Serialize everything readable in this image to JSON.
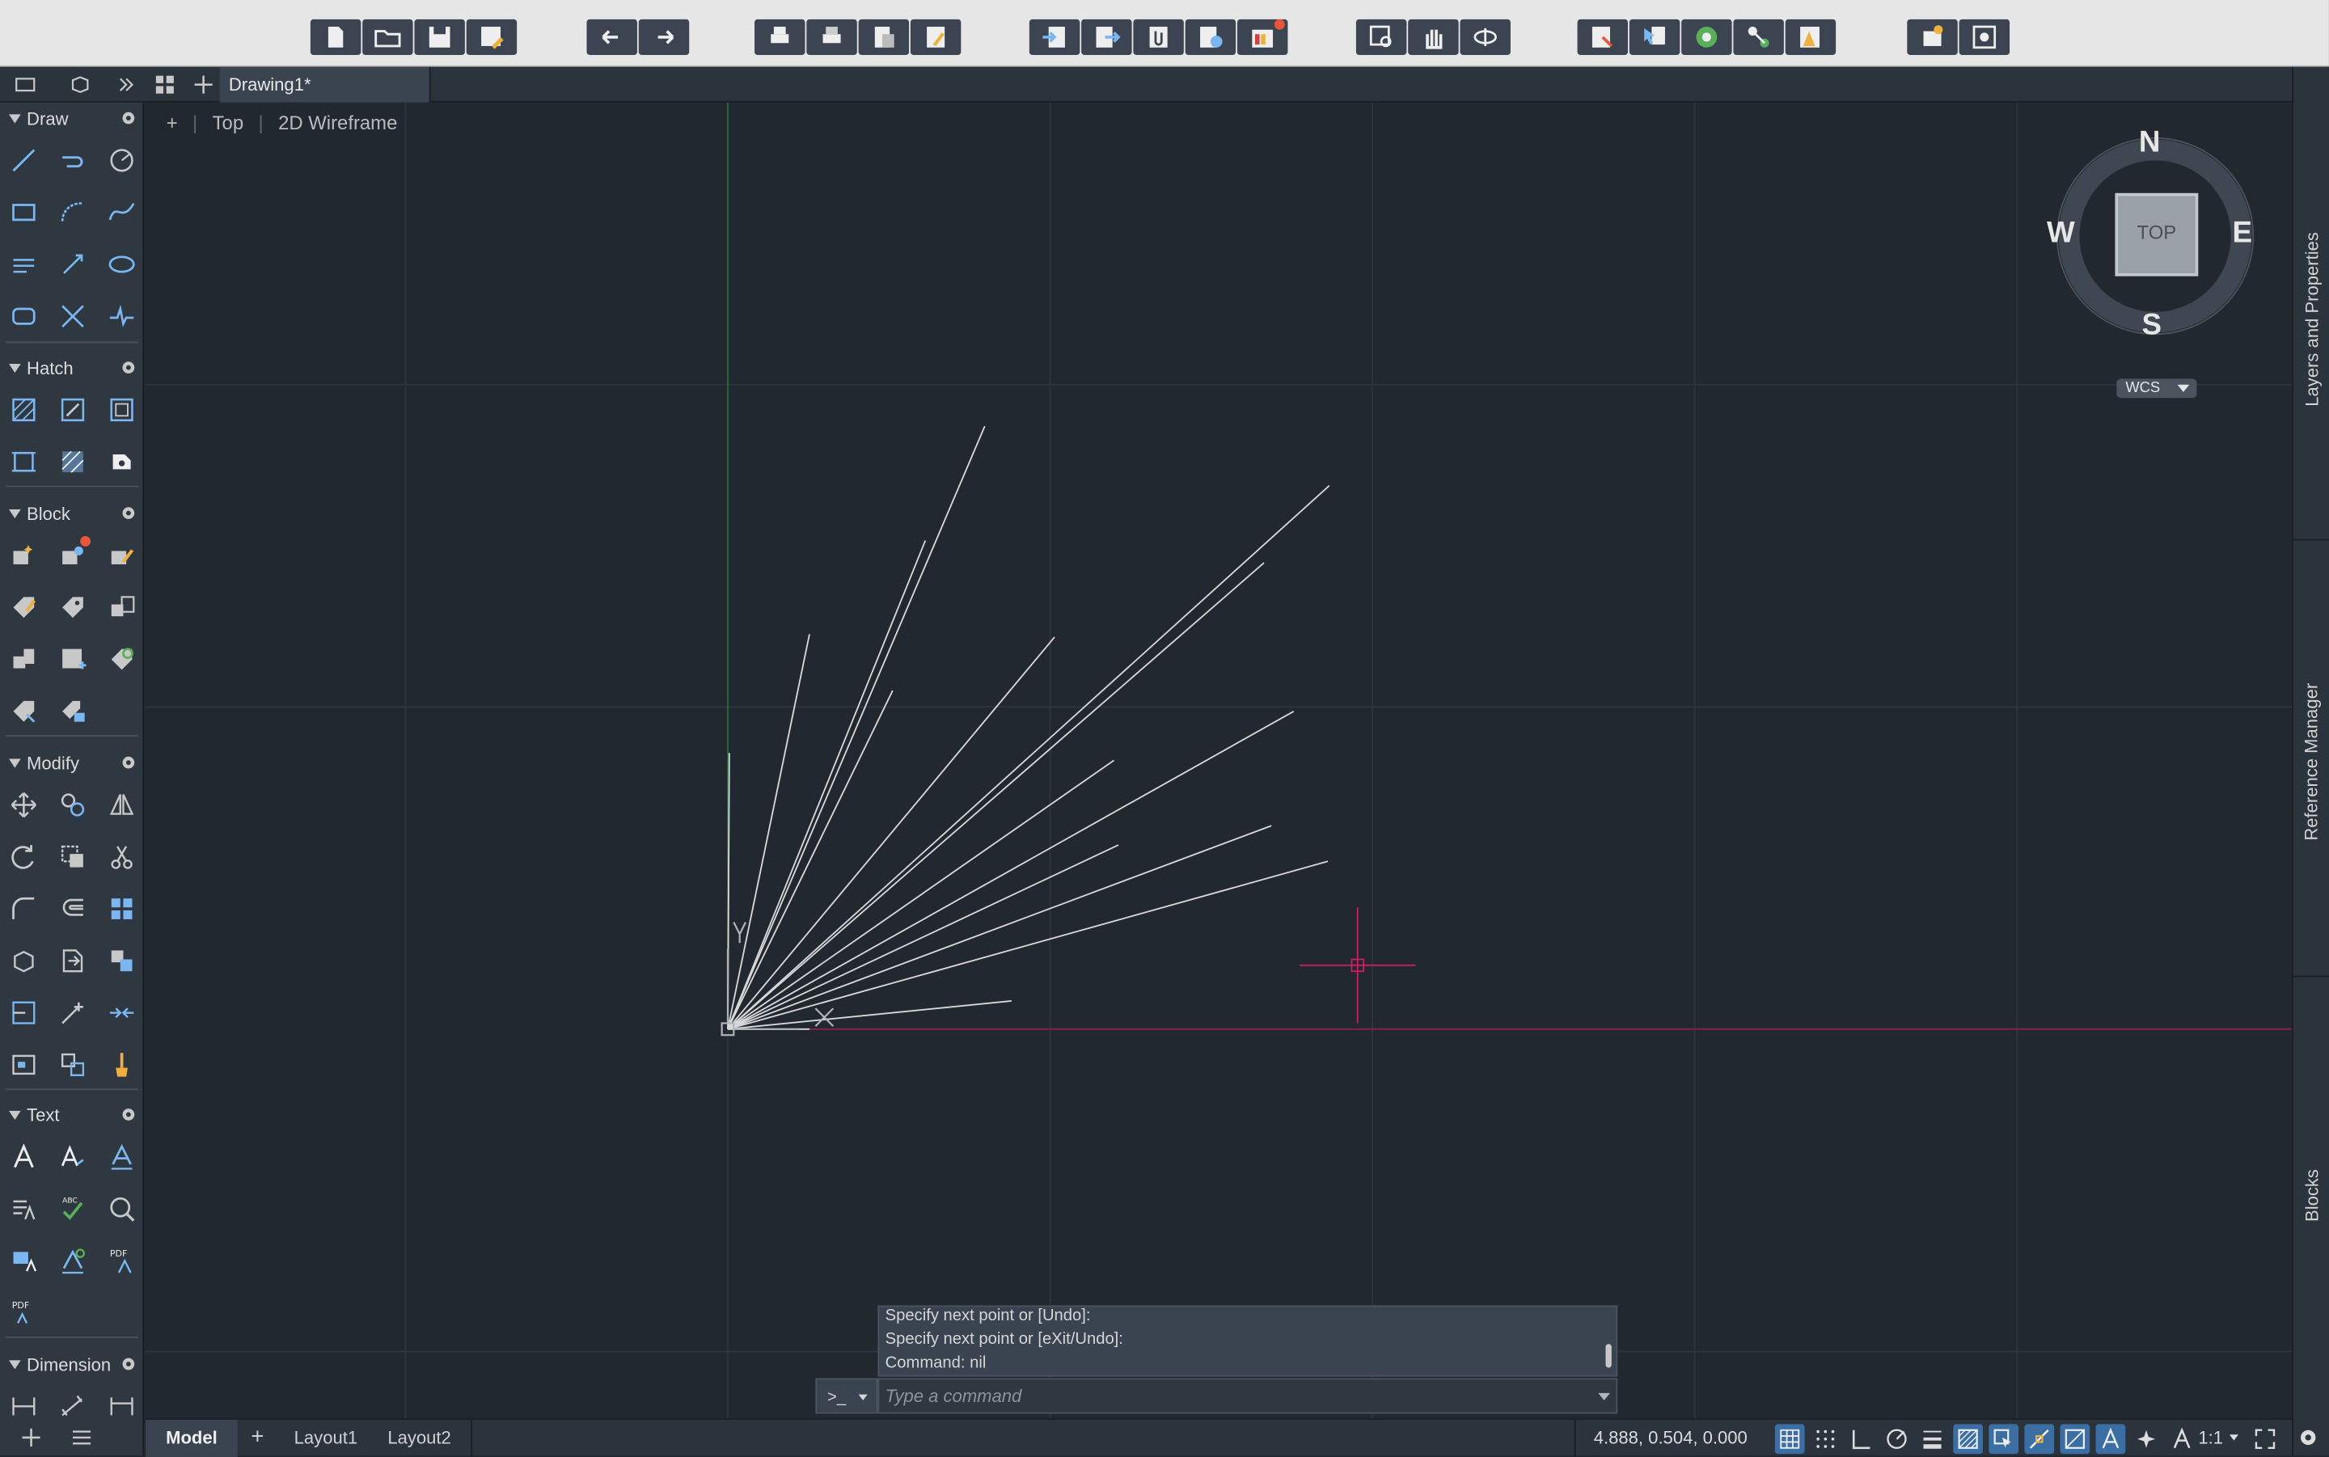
{
  "document_tab": {
    "label": "Drawing1*"
  },
  "viewport": {
    "plus": "+",
    "view": "Top",
    "style": "2D Wireframe"
  },
  "viewcube": {
    "north": "N",
    "south": "S",
    "east": "E",
    "west": "W",
    "top": "TOP",
    "ucs": "WCS"
  },
  "palette": {
    "sections": [
      {
        "key": "draw",
        "title": "Draw"
      },
      {
        "key": "hatch",
        "title": "Hatch"
      },
      {
        "key": "block",
        "title": "Block"
      },
      {
        "key": "modify",
        "title": "Modify"
      },
      {
        "key": "text",
        "title": "Text"
      },
      {
        "key": "dimension",
        "title": "Dimension"
      }
    ]
  },
  "right_panels": [
    "Layers and Properties",
    "Reference Manager",
    "Blocks"
  ],
  "command": {
    "history": [
      "Specify next point or [Undo]:",
      "Specify next point or [eXit/Undo]:",
      "Command: nil"
    ],
    "prompt": ">_",
    "placeholder": "Type a command"
  },
  "status": {
    "tabs": [
      "Model",
      "Layout1",
      "Layout2"
    ],
    "add_layout": "+",
    "coordinates": "4.888, 0.504, 0.000",
    "annotation_scale": "1:1"
  },
  "colors": {
    "canvas": "#212830",
    "grid_major": "#2e3742",
    "x_axis": "#8a2040",
    "y_axis": "#1f6b3a",
    "crosshair": "#c8205a",
    "lines": "#d8d8d8"
  }
}
